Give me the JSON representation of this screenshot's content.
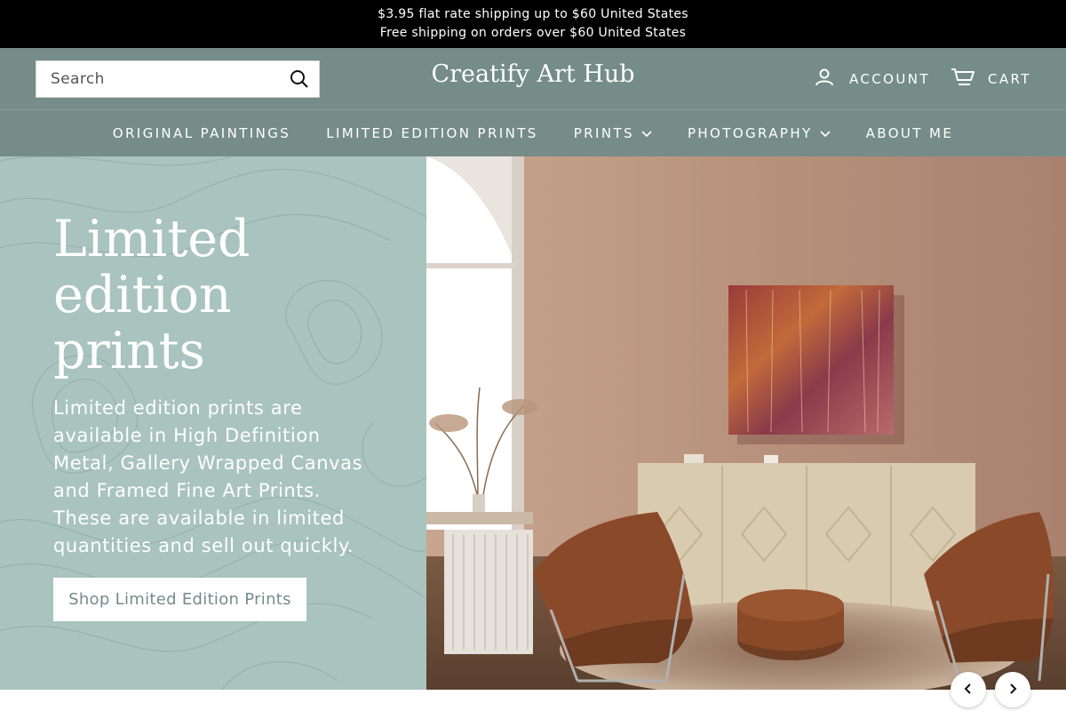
{
  "announcement": {
    "line1": "$3.95 flat rate shipping up to $60 United States",
    "line2": "Free shipping on orders over $60 United States"
  },
  "header": {
    "search_placeholder": "Search",
    "brand": "Creatify Art Hub",
    "account_label": "ACCOUNT",
    "cart_label": "CART"
  },
  "nav": {
    "items": [
      {
        "label": "ORIGINAL PAINTINGS"
      },
      {
        "label": "LIMITED EDITION PRINTS"
      },
      {
        "label": "PRINTS"
      },
      {
        "label": "PHOTOGRAPHY"
      },
      {
        "label": "ABOUT ME"
      }
    ]
  },
  "hero": {
    "title": "Limited edition prints",
    "body": "Limited edition prints are available in High Definition Metal, Gallery Wrapped Canvas and Framed Fine Art Prints. These are available in limited quantities and sell out quickly.",
    "button_label": "Shop Limited Edition Prints"
  },
  "slider": {
    "prev_icon": "chevron-left-icon",
    "next_icon": "chevron-right-icon"
  },
  "colors": {
    "announcement_bg": "#000000",
    "header_bg": "#758c88",
    "hero_panel_bg": "#a9c3bf",
    "wall": "#b99580"
  }
}
